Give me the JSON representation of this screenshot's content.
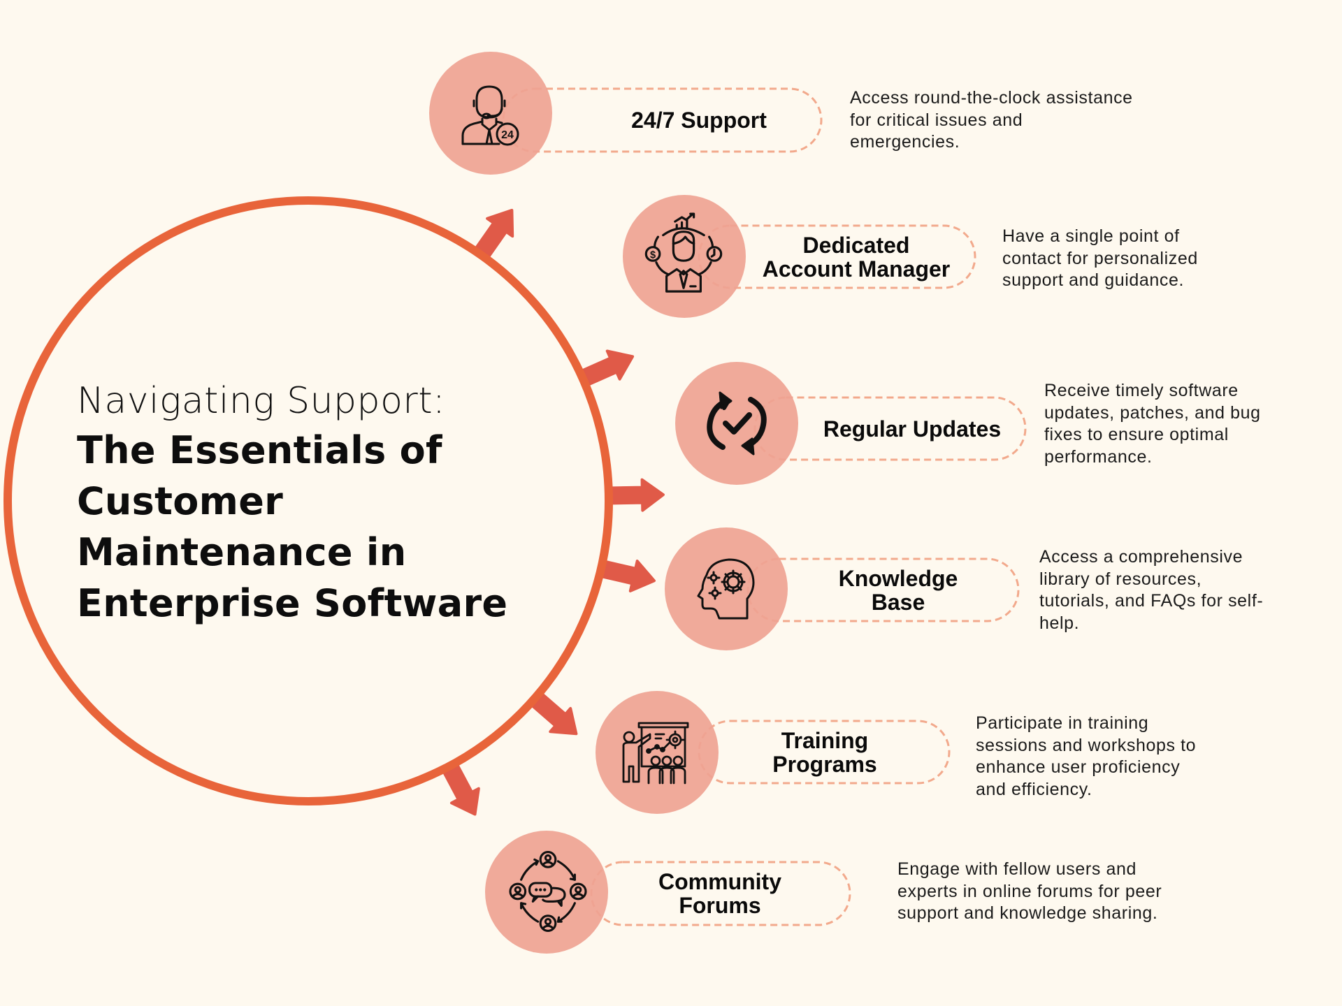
{
  "title": {
    "line1": "Navigating Support:",
    "bold_lines": [
      "The Essentials of",
      "Customer",
      "Maintenance in",
      "Enterprise Software"
    ]
  },
  "colors": {
    "background": "#FEF9EF",
    "main_ring": "#E8643A",
    "arrow": "#E05A48",
    "item_circle": "#EFA393",
    "dash": "#F2A98C",
    "text": "#0a0a0a"
  },
  "items": [
    {
      "id": "support-24-7",
      "label_lines": [
        "24/7 Support"
      ],
      "icon": "headset-agent-24-icon",
      "description_lines": [
        "Access round-the-clock assistance",
        "for critical issues and",
        "emergencies."
      ]
    },
    {
      "id": "dedicated-account-manager",
      "label_lines": [
        "Dedicated",
        "Account Manager"
      ],
      "icon": "account-manager-icon",
      "description_lines": [
        "Have a single point of",
        "contact for personalized",
        "support and guidance."
      ]
    },
    {
      "id": "regular-updates",
      "label_lines": [
        "Regular Updates"
      ],
      "icon": "refresh-check-icon",
      "description_lines": [
        "Receive timely software",
        "updates, patches, and bug",
        "fixes to ensure optimal",
        "performance."
      ]
    },
    {
      "id": "knowledge-base",
      "label_lines": [
        "Knowledge",
        "Base"
      ],
      "icon": "head-gears-icon",
      "description_lines": [
        "Access a comprehensive",
        "library of resources,",
        "tutorials, and FAQs for self-",
        "help."
      ]
    },
    {
      "id": "training-programs",
      "label_lines": [
        "Training",
        "Programs"
      ],
      "icon": "presentation-trainer-icon",
      "description_lines": [
        "Participate in training",
        "sessions and workshops to",
        "enhance user proficiency",
        "and efficiency."
      ]
    },
    {
      "id": "community-forums",
      "label_lines": [
        "Community",
        "Forums"
      ],
      "icon": "community-chat-icon",
      "description_lines": [
        "Engage with fellow users and",
        "experts in online forums for peer",
        "support and knowledge sharing."
      ]
    }
  ]
}
